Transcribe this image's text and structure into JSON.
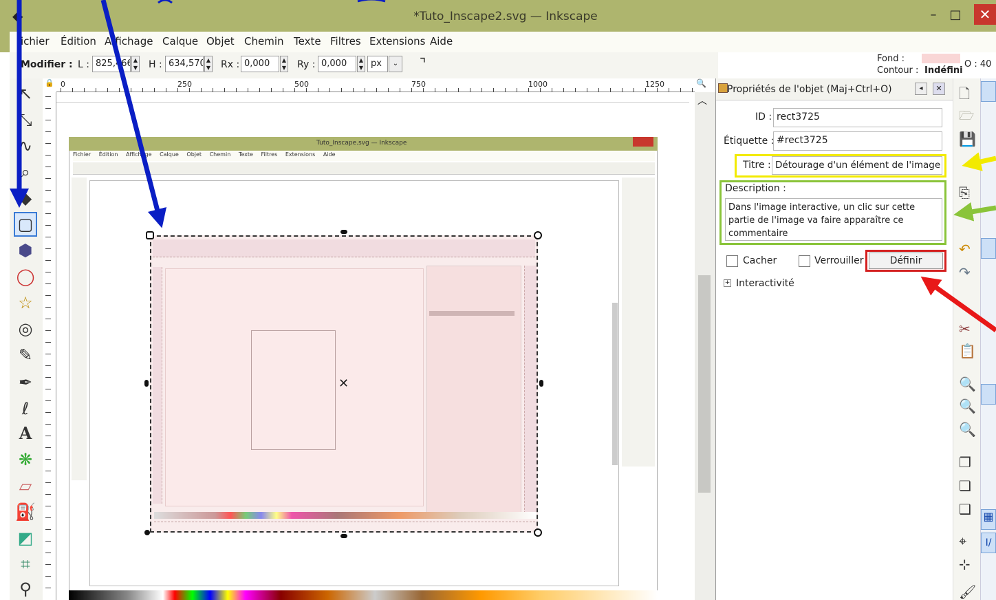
{
  "window": {
    "title": "*Tuto_Inscape2.svg — Inkscape",
    "min": "–",
    "max": "□",
    "close": "✕"
  },
  "menu": [
    "ichier",
    "Édition",
    "Affichage",
    "Calque",
    "Objet",
    "Chemin",
    "Texte",
    "Filtres",
    "Extensions",
    "Aide"
  ],
  "controls": {
    "modifier": "Modifier :",
    "l_label": "L :",
    "l_value": "825,466",
    "h_label": "H :",
    "h_value": "634,570",
    "rx_label": "Rx :",
    "rx_value": "0,000",
    "ry_label": "Ry :",
    "ry_value": "0,000",
    "unit": "px"
  },
  "style_indicator": {
    "fond_label": "Fond :",
    "contour_label": "Contour :",
    "contour_value": "Indéfini",
    "opacity": "O : 40"
  },
  "ruler": [
    "0",
    "250",
    "500",
    "750",
    "1000",
    "1250"
  ],
  "panel": {
    "title": "Propriétés de l'objet (Maj+Ctrl+O)",
    "id_label": "ID :",
    "id_value": "rect3725",
    "label_label": "Étiquette :",
    "label_value": "#rect3725",
    "title_label": "Titre :",
    "title_value": "Détourage d'un élément de l'image",
    "desc_label": "Description :",
    "desc_value": "Dans l'image interactive, un clic sur cette partie de l'image va faire apparaître ce commentaire",
    "hide_label": "Cacher",
    "lock_label": "Verrouiller",
    "set_button": "Définir",
    "interactivity_label": "Interactivité"
  },
  "nested": {
    "title": "Tuto_Inscape.svg — Inkscape",
    "menu": [
      "Fichier",
      "Édition",
      "Affichage",
      "Calque",
      "Objet",
      "Chemin",
      "Texte",
      "Filtres",
      "Extensions",
      "Aide"
    ]
  },
  "colors": {
    "titlebar": "#aeb56e",
    "highlight_yellow": "#f2ea00",
    "highlight_green": "#8ac43a",
    "highlight_red": "#d42020",
    "arrow_blue": "#0a1ec4",
    "arrow_red": "#e81818"
  }
}
